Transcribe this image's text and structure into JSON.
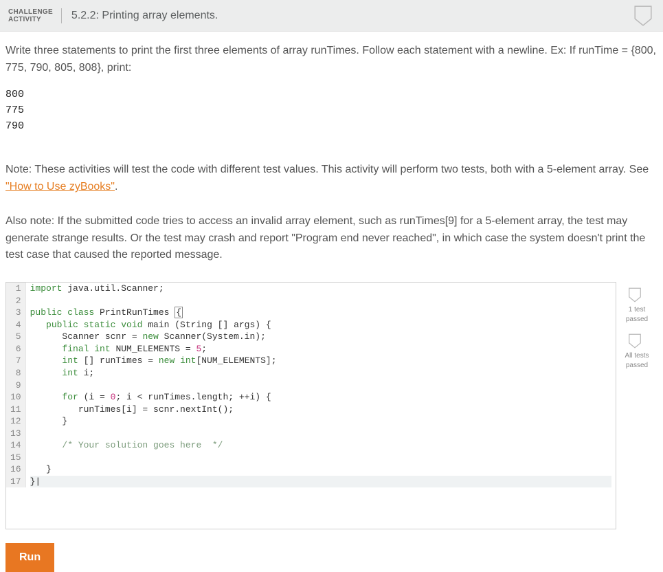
{
  "header": {
    "label_line1": "CHALLENGE",
    "label_line2": "ACTIVITY",
    "title": "5.2.2: Printing array elements."
  },
  "prompt": {
    "para1": "Write three statements to print the first three elements of array runTimes. Follow each statement with a newline. Ex: If runTime = {800, 775, 790, 805, 808}, print:",
    "sample_output": "800\n775\n790",
    "note1_pre": "Note: These activities will test the code with different test values. This activity will perform two tests, both with a 5-element array. See ",
    "note1_link": "\"How to Use zyBooks\"",
    "note1_post": ".",
    "note2": "Also note: If the submitted code tries to access an invalid array element, such as runTimes[9] for a 5-element array, the test may generate strange results. Or the test may crash and report \"Program end never reached\", in which case the system doesn't print the test case that caused the reported message."
  },
  "code": {
    "line_count": 17,
    "l1a": "import",
    "l1b": " java.util.Scanner;",
    "l3a": "public",
    "l3b": " class",
    "l3c": " PrintRunTimes ",
    "l4a": "   public",
    "l4b": " static",
    "l4c": " void",
    "l4d": " main (String [] args) {",
    "l5a": "      Scanner scnr = ",
    "l5b": "new",
    "l5c": " Scanner(System.in);",
    "l6a": "      final",
    "l6b": " int",
    "l6c": " NUM_ELEMENTS = ",
    "l6d": "5",
    "l6e": ";",
    "l7a": "      int",
    "l7b": " [] runTimes = ",
    "l7c": "new",
    "l7d": " int",
    "l7e": "[NUM_ELEMENTS];",
    "l8a": "      int",
    "l8b": " i;",
    "l10a": "      for",
    "l10b": " (i = ",
    "l10c": "0",
    "l10d": "; i < runTimes.length; ++i) {",
    "l11": "         runTimes[i] = scnr.nextInt();",
    "l12": "      }",
    "l14": "      /* Your solution goes here  */",
    "l16": "   }",
    "l17": "}"
  },
  "sidebar": {
    "item1_l1": "1 test",
    "item1_l2": "passed",
    "item2_l1": "All tests",
    "item2_l2": "passed"
  },
  "buttons": {
    "run": "Run"
  }
}
